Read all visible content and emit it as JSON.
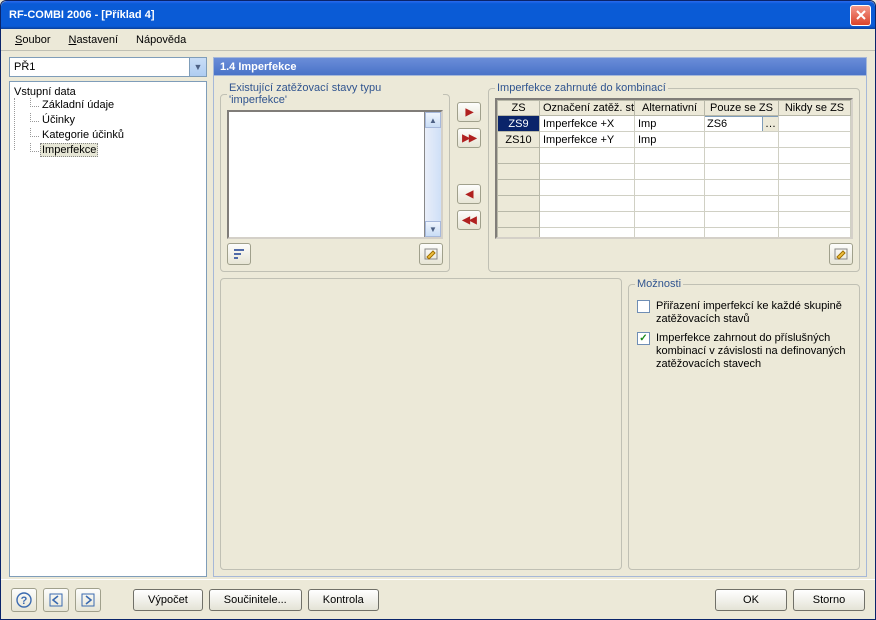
{
  "window": {
    "title": "RF-COMBI 2006 - [Příklad 4]"
  },
  "menu": {
    "file": "Soubor",
    "file_u": "S",
    "settings": "Nastavení",
    "settings_u": "N",
    "help": "Nápověda",
    "help_u": "N"
  },
  "combo": {
    "value": "PŘ1"
  },
  "tree": {
    "root": "Vstupní data",
    "items": [
      {
        "label": "Základní údaje"
      },
      {
        "label": "Účinky"
      },
      {
        "label": "Kategorie účinků"
      },
      {
        "label": "Imperfekce",
        "selected": true
      }
    ]
  },
  "pane": {
    "title": "1.4 Imperfekce"
  },
  "group_left": {
    "legend": "Existující zatěžovací stavy typu 'imperfekce'"
  },
  "transfer": {
    "right": "▶",
    "right_all": "▶▶",
    "left": "◀",
    "left_all": "◀◀"
  },
  "group_right": {
    "legend": "Imperfekce zahrnuté do kombinací",
    "headers": {
      "zs": "ZS",
      "label": "Označení zatěž. stavu",
      "alt": "Alternativní",
      "only": "Pouze se ZS",
      "never": "Nikdy se ZS"
    },
    "rows": [
      {
        "zs": "ZS9",
        "label": "Imperfekce +X",
        "alt": "Imp",
        "only": "ZS6",
        "never": "",
        "selected": true,
        "edit_only": true
      },
      {
        "zs": "ZS10",
        "label": "Imperfekce +Y",
        "alt": "Imp",
        "only": "",
        "never": ""
      }
    ]
  },
  "options": {
    "legend": "Možnosti",
    "opt1": {
      "checked": false,
      "label": "Přiřazení imperfekcí ke každé skupině zatěžovacích stavů"
    },
    "opt2": {
      "checked": true,
      "label": "Imperfekce zahrnout do příslušných kombinací v závislosti na definovaných zatěžovacích stavech"
    }
  },
  "footer": {
    "calc": "Výpočet",
    "factors": "Součinitele...",
    "check": "Kontrola",
    "ok": "OK",
    "cancel": "Storno"
  }
}
